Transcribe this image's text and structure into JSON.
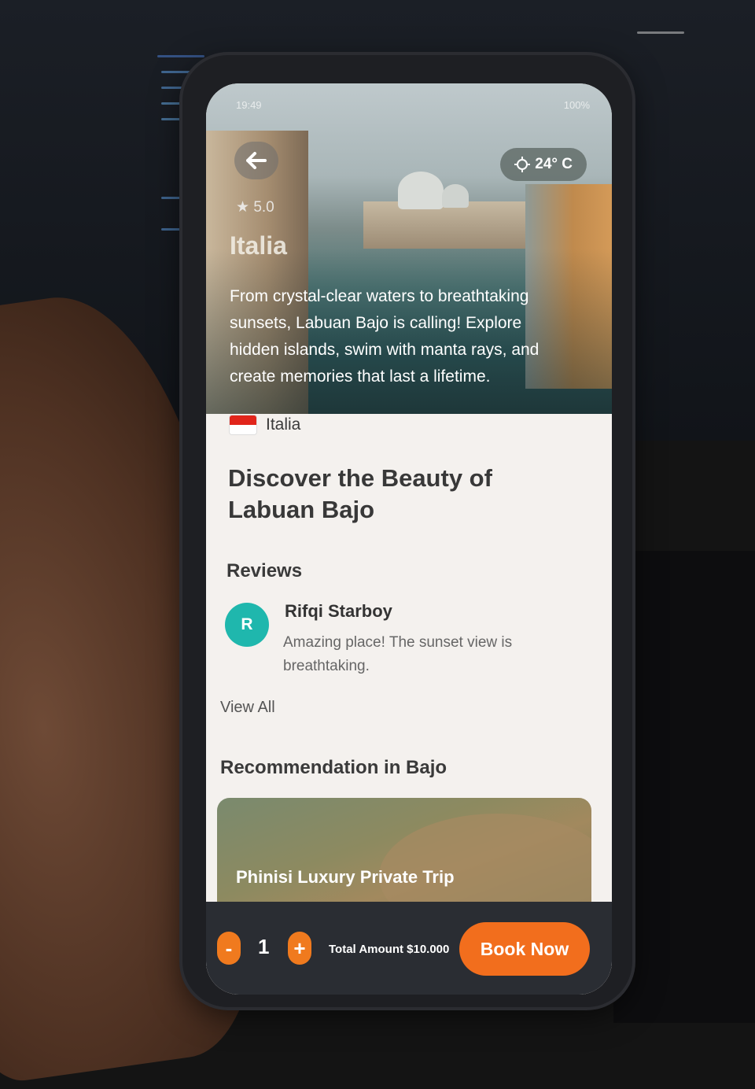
{
  "status_bar": {
    "time": "19:49",
    "battery": "100%"
  },
  "hero": {
    "back_icon": "arrow-left-icon",
    "weather": {
      "icon": "sun-icon",
      "value": "24° C"
    },
    "rating": "5.0",
    "title": "Italia",
    "description": "From crystal-clear waters to breathtaking sunsets, Labuan Bajo is calling! Explore hidden islands, swim with manta rays, and create memories that last a lifetime."
  },
  "location": {
    "flag_icon": "flag-icon",
    "country": "Italia"
  },
  "page_title": "Discover the Beauty of Labuan Bajo",
  "reviews": {
    "heading": "Reviews",
    "items": [
      {
        "initial": "R",
        "name": "Rifqi Starboy",
        "text": "Amazing place! The sunset view is breathtaking."
      }
    ],
    "view_all": "View All"
  },
  "recommendations": {
    "heading": "Recommendation in Bajo",
    "items": [
      {
        "title": "Phinisi Luxury Private Trip"
      }
    ]
  },
  "booking": {
    "minus": "-",
    "quantity": "1",
    "plus": "+",
    "total": "Total Amount $10.000",
    "book_label": "Book Now",
    "accent": "#f26e1d"
  }
}
